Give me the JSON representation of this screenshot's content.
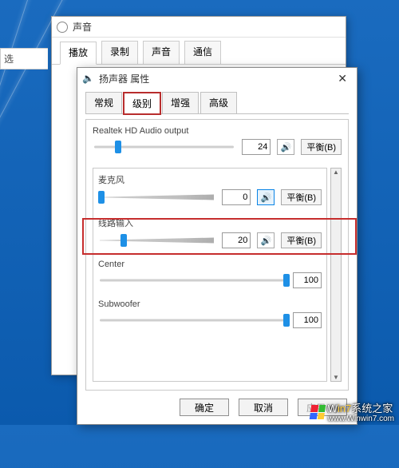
{
  "background_window": {
    "title": "声音",
    "tabs": [
      "播放",
      "录制",
      "声音",
      "通信"
    ],
    "active_tab": 0
  },
  "truncated_left_label": "选",
  "front_window": {
    "title": "扬声器 属性",
    "tabs": [
      "常规",
      "级别",
      "增强",
      "高级"
    ],
    "active_tab_index": 1,
    "groups": [
      {
        "label": "Realtek HD Audio output",
        "value": 24,
        "slider_pct": 18,
        "speaker_selected": false,
        "balance": "平衡(B)"
      },
      {
        "label": "麦克风",
        "value": 0,
        "slider_pct": 3,
        "speaker_selected": true,
        "balance": "平衡(B)",
        "highlighted": true
      },
      {
        "label": "线路输入",
        "value": 20,
        "slider_pct": 22,
        "speaker_selected": false,
        "balance": "平衡(B)"
      },
      {
        "label": "Center",
        "value": 100,
        "slider_pct": 100,
        "speaker_selected": false,
        "balance": null
      },
      {
        "label": "Subwoofer",
        "value": 100,
        "slider_pct": 100,
        "speaker_selected": false,
        "balance": null
      }
    ],
    "buttons": {
      "ok": "确定",
      "cancel": "取消",
      "apply": "应用(A)"
    }
  },
  "watermark": {
    "brand_pre": "W",
    "brand_accent": "in7",
    "brand_tail": "系统之家",
    "url": "www.Winwin7.com"
  },
  "icons": {
    "speaker": "🔊",
    "close": "✕",
    "title_icon": "🔈"
  }
}
